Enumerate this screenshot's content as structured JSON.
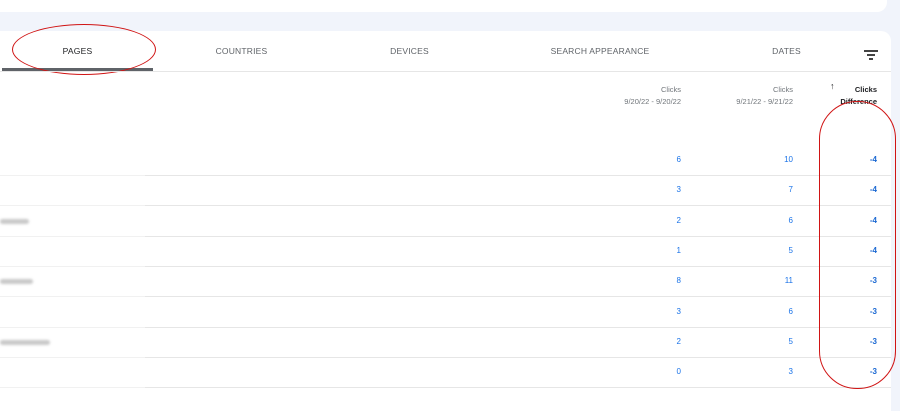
{
  "tabs": [
    {
      "label": "PAGES",
      "active": true
    },
    {
      "label": "COUNTRIES"
    },
    {
      "label": "DEVICES"
    },
    {
      "label": "SEARCH APPEARANCE"
    },
    {
      "label": "DATES"
    }
  ],
  "table": {
    "columns": [
      {
        "title": "Clicks",
        "subtitle": "9/20/22 - 9/20/22"
      },
      {
        "title": "Clicks",
        "subtitle": "9/21/22 - 9/21/22"
      },
      {
        "title": "Clicks",
        "subtitle": "Difference",
        "sorted": "ascending"
      }
    ],
    "sort_arrow": "↑",
    "rows": [
      {
        "c1": "6",
        "c2": "10",
        "diff": "-4"
      },
      {
        "c1": "3",
        "c2": "7",
        "diff": "-4"
      },
      {
        "c1": "2",
        "c2": "6",
        "diff": "-4"
      },
      {
        "c1": "1",
        "c2": "5",
        "diff": "-4"
      },
      {
        "c1": "8",
        "c2": "11",
        "diff": "-3"
      },
      {
        "c1": "3",
        "c2": "6",
        "diff": "-3"
      },
      {
        "c1": "2",
        "c2": "5",
        "diff": "-3"
      },
      {
        "c1": "0",
        "c2": "3",
        "diff": "-3"
      }
    ]
  },
  "colors": {
    "accent": "#1a73e8",
    "annotation": "#d01414"
  },
  "icons": {
    "filter": "filter-icon",
    "sort": "arrow-up-icon"
  }
}
